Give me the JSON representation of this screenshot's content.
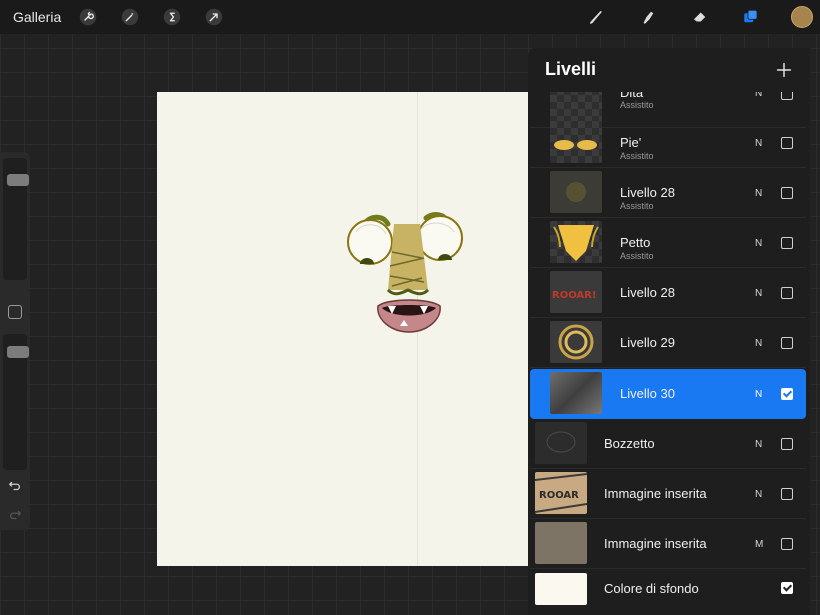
{
  "topbar": {
    "gallery_label": "Galleria",
    "left_tools": [
      "wrench-icon",
      "magic-wand-icon",
      "selection-s-icon",
      "transform-arrow-icon"
    ],
    "right_tools": [
      "brush-icon",
      "smudge-icon",
      "eraser-icon",
      "layers-icon"
    ],
    "active_color": "#a7834d",
    "accent": "#1879f2"
  },
  "sidebar": {
    "brush_size_level": 0.15,
    "opacity_level": 0.1,
    "icons": [
      "modify-square-icon",
      "undo-icon",
      "redo-icon"
    ]
  },
  "layers_panel": {
    "title": "Livelli",
    "add_icon": "plus-icon",
    "layers": [
      {
        "name": "Dita",
        "sub": "Assistito",
        "blend": "N",
        "visible": false,
        "selected": false
      },
      {
        "name": "Pie'",
        "sub": "Assistito",
        "blend": "N",
        "visible": false,
        "selected": false
      },
      {
        "name": "Livello 28",
        "sub": "Assistito",
        "blend": "N",
        "visible": false,
        "selected": false
      },
      {
        "name": "Petto",
        "sub": "Assistito",
        "blend": "N",
        "visible": false,
        "selected": false
      },
      {
        "name": "Livello 28",
        "sub": "",
        "blend": "N",
        "visible": false,
        "selected": false
      },
      {
        "name": "Livello 29",
        "sub": "",
        "blend": "N",
        "visible": false,
        "selected": false
      },
      {
        "name": "Livello 30",
        "sub": "",
        "blend": "N",
        "visible": true,
        "selected": true
      },
      {
        "name": "Bozzetto",
        "sub": "",
        "blend": "N",
        "visible": false,
        "selected": false
      },
      {
        "name": "Immagine inserita",
        "sub": "",
        "blend": "N",
        "visible": false,
        "selected": false
      },
      {
        "name": "Immagine inserita",
        "sub": "",
        "blend": "M",
        "visible": false,
        "selected": false
      },
      {
        "name": "Colore di sfondo",
        "sub": "",
        "blend": "",
        "visible": true,
        "selected": false
      }
    ]
  }
}
